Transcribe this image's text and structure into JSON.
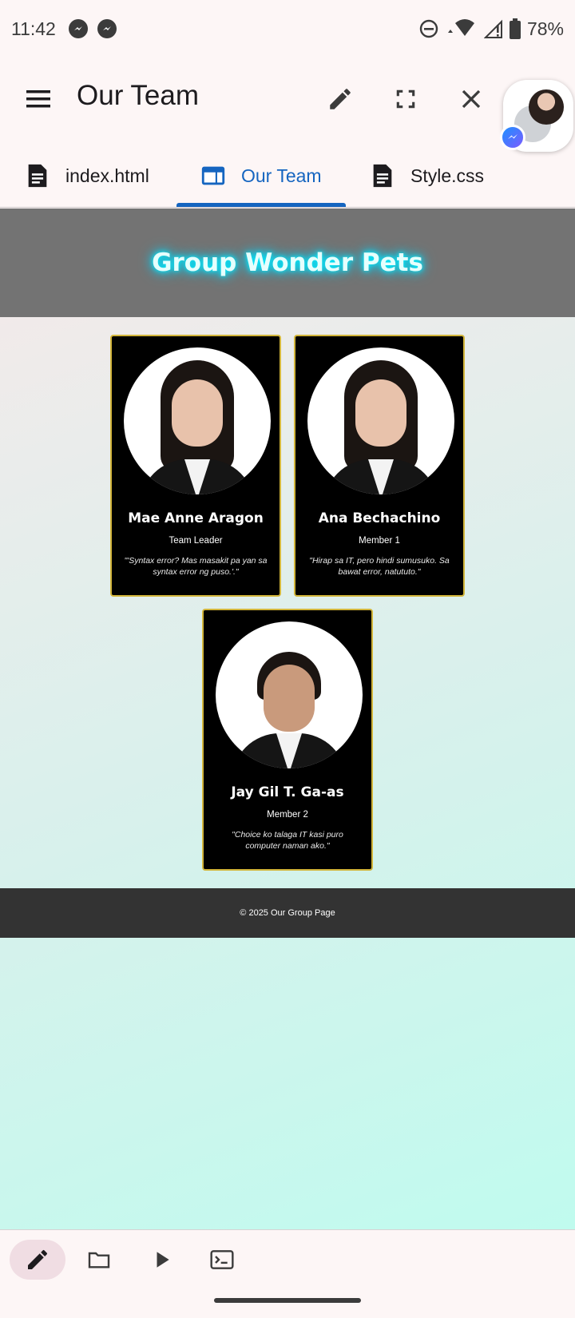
{
  "status_bar": {
    "time": "11:42",
    "battery": "78%",
    "icons": [
      "messenger-icon",
      "messenger-icon",
      "dnd-icon",
      "wifi-icon",
      "signal-icon",
      "battery-icon"
    ]
  },
  "app_bar": {
    "title": "Our Team",
    "actions": [
      "edit-icon",
      "fullscreen-icon",
      "close-icon"
    ]
  },
  "tabs": [
    {
      "label": "index.html",
      "icon": "file-icon",
      "active": false
    },
    {
      "label": "Our Team",
      "icon": "web-preview-icon",
      "active": true
    },
    {
      "label": "Style.css",
      "icon": "file-icon",
      "active": false
    }
  ],
  "page": {
    "title": "Group Wonder Pets",
    "members": [
      {
        "name": "Mae Anne Aragon",
        "role": "Team Leader",
        "quote": "\"'Syntax error? Mas masakit pa yan sa syntax error ng puso.'.\""
      },
      {
        "name": "Ana Bechachino",
        "role": "Member 1",
        "quote": "\"Hirap sa IT, pero hindi sumusuko. Sa bawat error, natututo.\""
      },
      {
        "name": "Jay Gil T. Ga-as",
        "role": "Member 2",
        "quote": "\"Choice ko talaga IT kasi puro computer naman ako.\""
      }
    ],
    "footer": "© 2025 Our Group Page"
  },
  "bottom_bar": [
    "edit-icon",
    "folder-icon",
    "run-icon",
    "terminal-icon"
  ],
  "colors": {
    "accent": "#1565c0",
    "card_border": "#d2b53a",
    "title_glow": "#00f0ff"
  }
}
